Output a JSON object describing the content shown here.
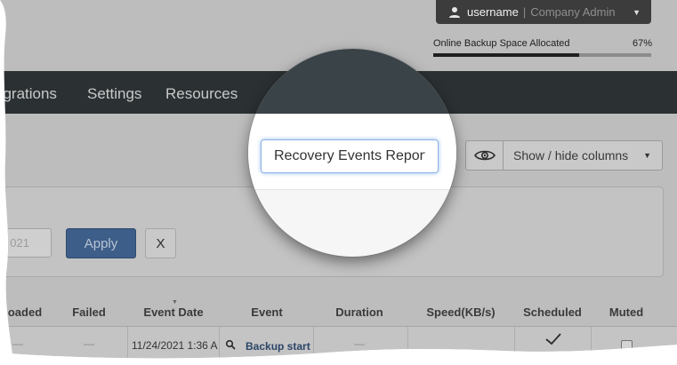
{
  "account": {
    "username": "username",
    "separator": "|",
    "role": "Company Admin",
    "caret": "▼"
  },
  "storage": {
    "label": "Online Backup Space Allocated",
    "percent_text": "67%",
    "percent": 67
  },
  "nav": {
    "items": [
      "egrations",
      "Settings",
      "Resources"
    ]
  },
  "report": {
    "value": "Recovery Events Report"
  },
  "columns_toggle": {
    "label": "Show / hide columns",
    "caret": "▼"
  },
  "filter": {
    "date_value": "021",
    "apply_label": "Apply",
    "clear_label": "X"
  },
  "table": {
    "headers": [
      "oaded",
      "Failed",
      "Event Date",
      "Event",
      "Duration",
      "Speed(KB/s)",
      "Scheduled",
      "Muted"
    ],
    "row": {
      "uploaded": "—",
      "failed": "—",
      "event_date": "11/24/2021 1:36 A",
      "event": "Backup start",
      "duration": "—"
    }
  },
  "colors": {
    "navbar": "#2b3133",
    "account_pill": "#3c3c3c",
    "apply_button": "#3d5e89",
    "focus_ring": "#8fb5e6"
  }
}
